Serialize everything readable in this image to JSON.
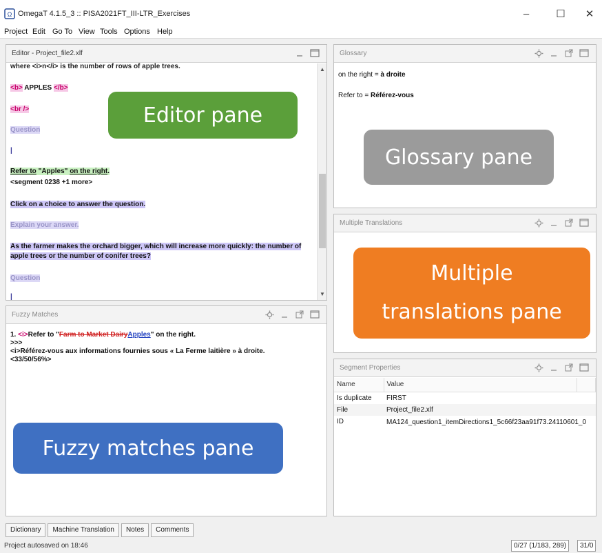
{
  "window": {
    "title": "OmegaT 4.1.5_3 :: PISA2021FT_III-LTR_Exercises",
    "controls": [
      "–",
      "☐",
      "✕"
    ]
  },
  "menu": [
    "Project",
    "Edit",
    "Go To",
    "View",
    "Tools",
    "Options",
    "Help"
  ],
  "editor": {
    "title": "Editor - Project_file2.xlf",
    "lines": {
      "l0": "where <i>n</i> is the number of rows of apple trees.",
      "tag_b_open": "<b>",
      "apples": " APPLES ",
      "tag_b_close": "</b>",
      "tag_br": "<br />",
      "question1": "Question",
      "cursor": "|",
      "refer_a": "Refer to",
      "refer_b": " \"Apples\" ",
      "refer_c": "on the right",
      "refer_d": ".",
      "segment": "<segment 0238 +1 more>",
      "click": "Click on a choice to answer the question.",
      "explain": "Explain your answer.",
      "farmer": "As the farmer makes the orchard bigger, which will increase more quickly: the number of apple trees or the number of conifer trees?",
      "question2": "Question",
      "cursor2": "|"
    }
  },
  "fuzzy": {
    "title": "Fuzzy Matches",
    "num": "1. ",
    "tag_i": "<i>",
    "refer": "Refer to \"",
    "deleted": "Farm to Market Dairy",
    "inserted": "Apples",
    "rest": "\" on the right.",
    "arrows": ">>>",
    "translation": "<i>Référez-vous aux informations fournies sous « La Ferme laitière » à droite.",
    "score": "<33/50/56%>"
  },
  "glossary": {
    "title": "Glossary",
    "entries": [
      {
        "src": "on the right = ",
        "tgt": "à droite"
      },
      {
        "src": "Refer to = ",
        "tgt": "Référez-vous"
      }
    ]
  },
  "multiple": {
    "title": "Multiple Translations"
  },
  "segprops": {
    "title": "Segment Properties",
    "headers": {
      "name": "Name",
      "value": "Value"
    },
    "rows": [
      {
        "name": "Is duplicate",
        "value": "FIRST"
      },
      {
        "name": "File",
        "value": "Project_file2.xlf"
      },
      {
        "name": "ID",
        "value": "MA124_question1_itemDirections1_5c66f23aa91f73.24110601_0"
      }
    ]
  },
  "callouts": {
    "editor": "Editor pane",
    "glossary": "Glossary pane",
    "multiple_l1": "Multiple",
    "multiple_l2": "translations pane",
    "fuzzy": "Fuzzy matches pane"
  },
  "tabs": [
    "Dictionary",
    "Machine Translation",
    "Notes",
    "Comments"
  ],
  "status": {
    "left": "Project autosaved on 18:46",
    "progress": "0/27 (1/183, 289)",
    "count": "31/0"
  },
  "colors": {
    "editor_callout": "#5b9f3a",
    "glossary_callout": "#9b9b9b",
    "multiple_callout": "#ef7d22",
    "fuzzy_callout": "#3f70c2"
  },
  "icons": [
    "app-logo-icon",
    "gear-icon",
    "minimize-pane-icon",
    "undock-icon",
    "maximize-pane-icon"
  ]
}
